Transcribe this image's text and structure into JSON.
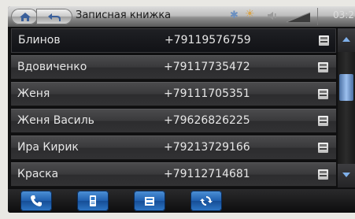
{
  "header": {
    "title": "Записная книжка",
    "clock": "03:2",
    "icons": [
      "home-icon",
      "back-icon",
      "bluetooth-icon",
      "brightness-icon",
      "volume-icon",
      "signal-icon"
    ]
  },
  "contacts": [
    {
      "name": "Блинов",
      "phone": "+79119576759",
      "selected": true
    },
    {
      "name": "Вдовиченко",
      "phone": "+79117735472",
      "selected": false
    },
    {
      "name": "Женя",
      "phone": "+79111705351",
      "selected": false
    },
    {
      "name": "Женя Василь",
      "phone": "+79626826225",
      "selected": false
    },
    {
      "name": "Ира Кирик",
      "phone": "+79213729166",
      "selected": false
    },
    {
      "name": "Краска",
      "phone": "+79112714681",
      "selected": false
    }
  ],
  "toolbar": {
    "buttons": [
      "call-icon",
      "phone-device-icon",
      "sms-icon",
      "sync-icon"
    ]
  },
  "colors": {
    "accent": "#2f78c8",
    "scroll_thumb": "#9cc0ef"
  }
}
